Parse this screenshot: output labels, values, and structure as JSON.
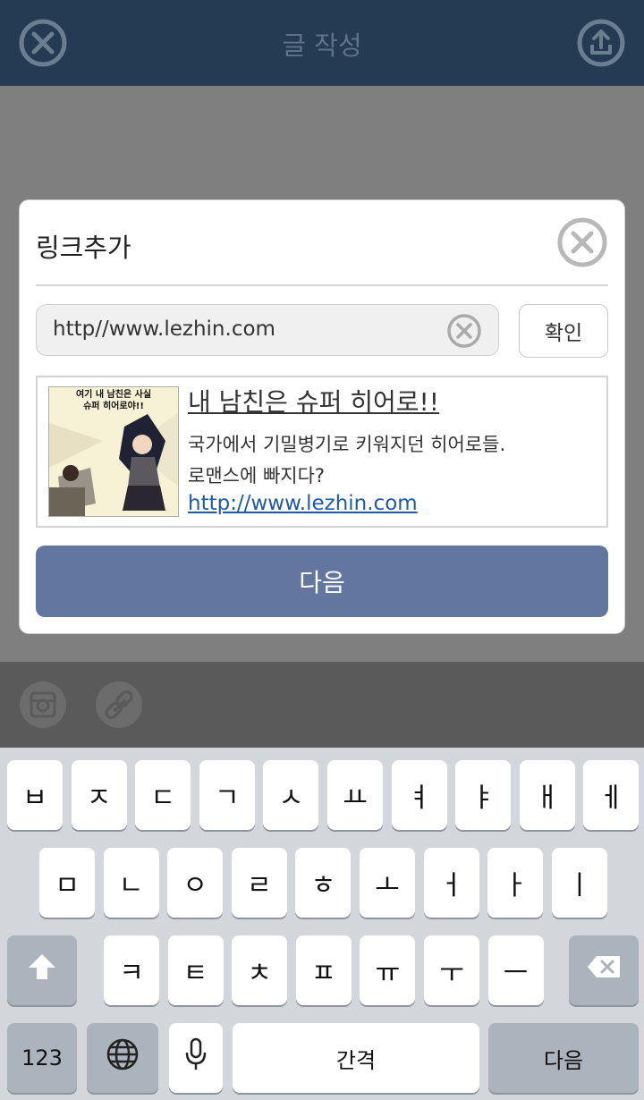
{
  "header": {
    "title": "글 작성",
    "close_icon": "close-circle-icon",
    "upload_icon": "upload-icon"
  },
  "toolbar": {
    "instagram_icon": "instagram-icon",
    "link_icon": "link-icon"
  },
  "dialog": {
    "title": "링크추가",
    "url_value": "http//www.lezhin.com",
    "confirm_label": "확인",
    "preview": {
      "thumb_caption_line1": "여기 내 남친은 사실",
      "thumb_caption_line2": "슈퍼 히어로야!!",
      "title": "내 남친은 슈퍼 히어로!!",
      "desc_line1": "국가에서 기밀병기로 키워지던 히어로들.",
      "desc_line2": "로맨스에 빠지다?",
      "link": "http://www.lezhin.com"
    },
    "next_label": "다음"
  },
  "keyboard": {
    "row1": [
      "ㅂ",
      "ㅈ",
      "ㄷ",
      "ㄱ",
      "ㅅ",
      "ㅛ",
      "ㅕ",
      "ㅑ",
      "ㅐ",
      "ㅔ"
    ],
    "row2": [
      "ㅁ",
      "ㄴ",
      "ㅇ",
      "ㄹ",
      "ㅎ",
      "ㅗ",
      "ㅓ",
      "ㅏ",
      "ㅣ"
    ],
    "row3": [
      "ㅋ",
      "ㅌ",
      "ㅊ",
      "ㅍ",
      "ㅠ",
      "ㅜ",
      "ㅡ"
    ],
    "numbers_label": "123",
    "space_label": "간격",
    "return_label": "다음"
  },
  "colors": {
    "header_bg": "#253b54",
    "accent_button": "#6276a0",
    "link": "#1f5aa6"
  }
}
